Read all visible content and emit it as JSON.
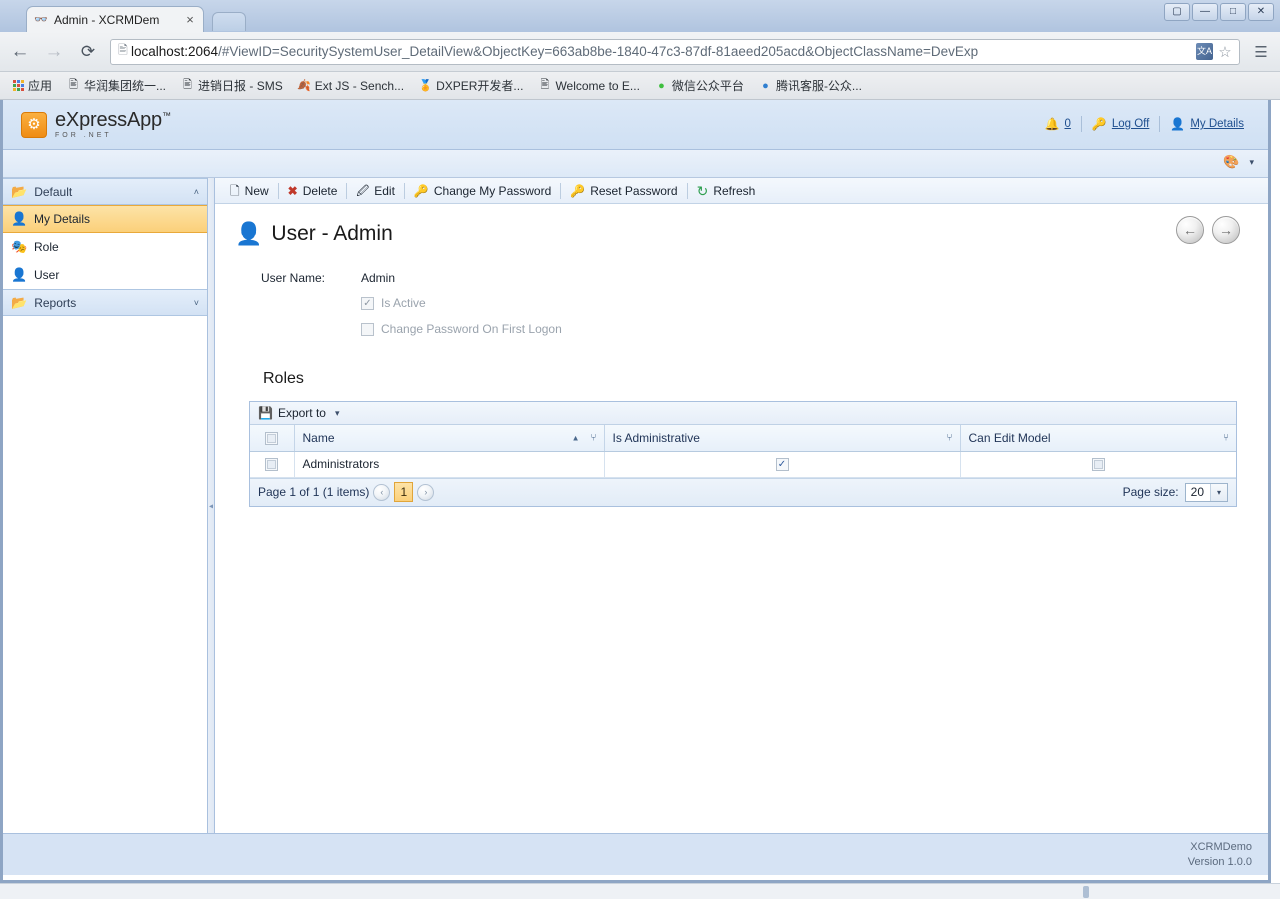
{
  "browser": {
    "tab": {
      "title": "Admin - XCRMDem",
      "favicon": "binoculars-icon",
      "close_label": "×"
    },
    "new_tab_label": "",
    "window_controls": [
      {
        "name": "user-switch-button",
        "glyph": "▢"
      },
      {
        "name": "minimize-button",
        "glyph": "—"
      },
      {
        "name": "maximize-button",
        "glyph": "□"
      },
      {
        "name": "close-button",
        "glyph": "✕"
      }
    ],
    "nav": {
      "back_label": "←",
      "forward_label": "→",
      "reload_label": "⟳"
    },
    "omnibox": {
      "url_host": "localhost:2064",
      "url_path": "/#ViewID=SecuritySystemUser_DetailView&ObjectKey=663ab8be-1840-47c3-87df-81aeed205acd&ObjectClassName=DevExp",
      "translate_label": "文A",
      "star_label": "☆"
    },
    "menu_label": "☰",
    "bookmarks": [
      {
        "label": "应用",
        "icon": "apps-grid-icon"
      },
      {
        "label": "华润集团统一...",
        "icon": "page-icon"
      },
      {
        "label": "进销日报 - SMS",
        "icon": "page-icon"
      },
      {
        "label": "Ext JS - Sench...",
        "icon": "leaf-icon"
      },
      {
        "label": "DXPER开发者...",
        "icon": "trophy-icon"
      },
      {
        "label": "Welcome to E...",
        "icon": "page-icon"
      },
      {
        "label": "微信公众平台",
        "icon": "wechat-icon"
      },
      {
        "label": "腾讯客服-公众...",
        "icon": "qq-icon"
      }
    ]
  },
  "app": {
    "logo": {
      "main": "eXpressApp",
      "trademark": "™",
      "sub": "FOR .NET"
    },
    "header_links": {
      "notifications_count": "0",
      "log_off": "Log Off",
      "my_details": "My Details"
    },
    "theme_chooser": {
      "label": "",
      "caret": "▾"
    },
    "footer": {
      "app_name": "XCRMDemo",
      "version": "Version 1.0.0"
    }
  },
  "sidebar": {
    "groups": [
      {
        "label": "Default",
        "expanded": true,
        "caret": "˄",
        "items": [
          {
            "label": "My Details",
            "icon": "user-info-icon",
            "selected": true
          },
          {
            "label": "Role",
            "icon": "mask-icon",
            "selected": false
          },
          {
            "label": "User",
            "icon": "user-key-icon",
            "selected": false
          }
        ]
      },
      {
        "label": "Reports",
        "expanded": false,
        "caret": "˅",
        "items": []
      }
    ]
  },
  "toolbar": {
    "buttons": [
      {
        "label": "New",
        "icon": "new-document-icon"
      },
      {
        "label": "Delete",
        "icon": "delete-x-icon"
      },
      {
        "label": "Edit",
        "icon": "edit-pencil-icon"
      },
      {
        "label": "Change My Password",
        "icon": "key-icon"
      },
      {
        "label": "Reset Password",
        "icon": "reset-key-icon"
      },
      {
        "label": "Refresh",
        "icon": "refresh-icon"
      }
    ]
  },
  "detail_view": {
    "title": "User - Admin",
    "icon": "user-key-icon",
    "nav_prev": "←",
    "nav_next": "→",
    "fields": [
      {
        "label": "User Name:",
        "value": "Admin"
      }
    ],
    "checkboxes": [
      {
        "label": "Is Active",
        "checked": true,
        "mark": "✓"
      },
      {
        "label": "Change Password On First Logon",
        "checked": false,
        "mark": ""
      }
    ]
  },
  "roles": {
    "section_title": "Roles",
    "grid_toolbar": {
      "export_label": "Export to",
      "export_icon": "save-disk-icon",
      "export_caret": "▾"
    },
    "columns": [
      {
        "key": "select",
        "label": "",
        "type": "checkbox-select"
      },
      {
        "key": "name",
        "label": "Name",
        "sorted": "asc",
        "sort_glyph": "▲",
        "filter_glyph": "⑂"
      },
      {
        "key": "is_administrative",
        "label": "Is Administrative",
        "filter_glyph": "⑂"
      },
      {
        "key": "can_edit_model",
        "label": "Can Edit Model",
        "filter_glyph": "⑂"
      }
    ],
    "rows": [
      {
        "selected": false,
        "name": "Administrators",
        "is_administrative": true,
        "can_edit_model": false
      }
    ],
    "pager": {
      "summary": "Page 1 of 1 (1 items)",
      "prev_glyph": "‹",
      "next_glyph": "›",
      "current_page": "1",
      "page_size_label": "Page size:",
      "page_size_value": "20",
      "page_size_caret": "▾"
    }
  },
  "colors": {
    "accent_orange": "#fbd07a",
    "chrome_blue": "#b0c4df",
    "panel_blue": "#d6e3f4",
    "link_blue": "#1f4f8f"
  }
}
